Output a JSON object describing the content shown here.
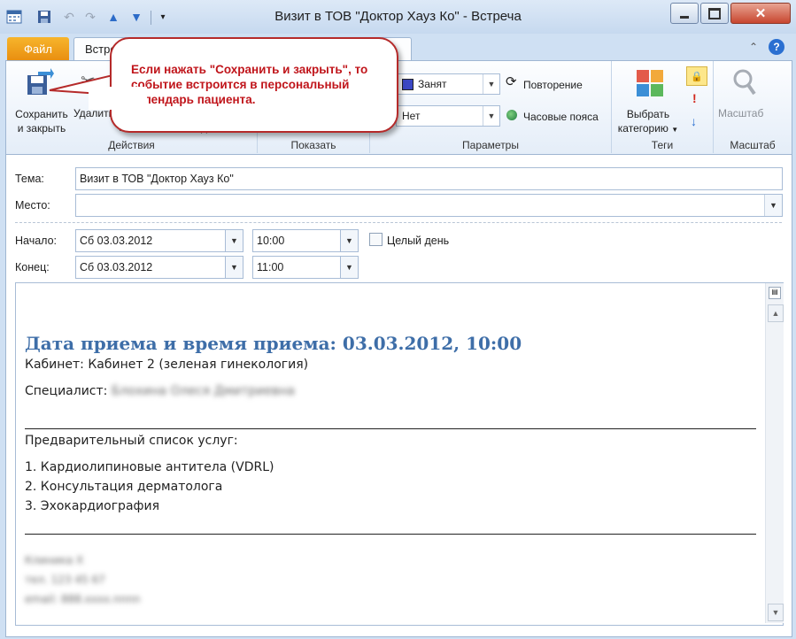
{
  "window": {
    "title": "Визит в ТОВ \"Доктор Хауз  Ко\"  -  Встреча"
  },
  "tabs": {
    "file": "Файл",
    "meeting": "Встреча"
  },
  "ribbon": {
    "actions": {
      "save_close_line1": "Сохранить",
      "save_close_line2": "и закрыть",
      "delete_label": "Удалить",
      "group_label": "Действия"
    },
    "show": {
      "group_label": "Показать"
    },
    "options": {
      "show_as": "Занят",
      "reminder": "Нет",
      "recurrence": "Повторение",
      "timezones": "Часовые пояса",
      "group_label": "Параметры"
    },
    "tags": {
      "categorize_line1": "Выбрать",
      "categorize_line2": "категорию",
      "group_label": "Теги"
    },
    "zoom": {
      "zoom_label": "Масштаб",
      "group_label": "Масштаб"
    }
  },
  "callout": {
    "text": "Если нажать \"Сохранить и закрыть\", то событие встроится в персональный календарь пациента."
  },
  "form": {
    "subject_label": "Тема:",
    "subject_value": "Визит в ТОВ \"Доктор Хауз  Ко\"",
    "location_label": "Место:",
    "location_value": "",
    "start_label": "Начало:",
    "start_date": "Сб 03.03.2012",
    "start_time": "10:00",
    "allday_label": "Целый день",
    "end_label": "Конец:",
    "end_date": "Сб 03.03.2012",
    "end_time": "11:00"
  },
  "body": {
    "heading": "Дата приема и время приема: 03.03.2012, 10:00",
    "cabinet": "Кабинет: Кабинет  2 (зеленая гинекология)",
    "specialist_label": "Специалист:",
    "specialist_name": "Блохина Олеся Дмитриевна",
    "services_title": "Предварительный список услуг:",
    "services": [
      "1.  Кардиолипиновые антитела (VDRL)",
      "2.  Консультация дерматолога",
      "3.  Эхокардиография"
    ],
    "footer_lines": [
      "Клиника X",
      "тел. 123 45 67",
      "email: 888.xxxx.nnnn"
    ]
  },
  "colors": {
    "accent": "#3e6ea8",
    "callout_border": "#b52a2a",
    "callout_text": "#c0151b",
    "file_tab": "#e98f10"
  }
}
